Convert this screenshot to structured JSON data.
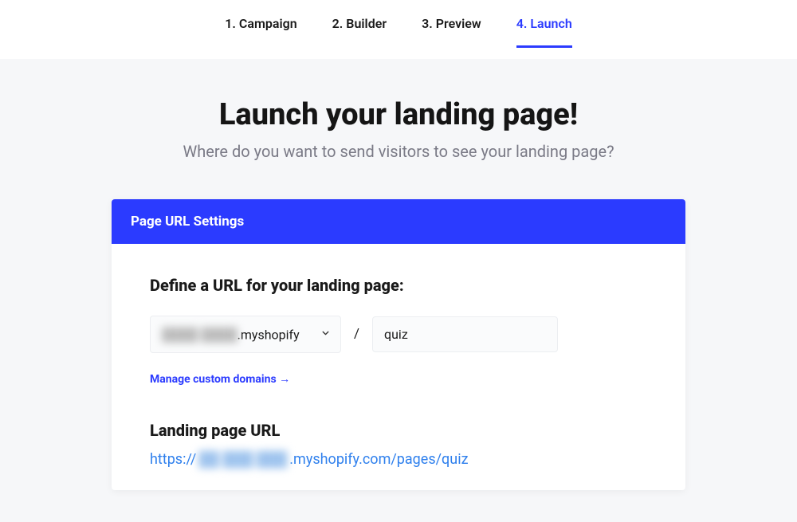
{
  "steps": [
    {
      "label": "1. Campaign",
      "active": false
    },
    {
      "label": "2. Builder",
      "active": false
    },
    {
      "label": "3. Preview",
      "active": false
    },
    {
      "label": "4. Launch",
      "active": true
    }
  ],
  "hero": {
    "title": "Launch your landing page!",
    "subtitle": "Where do you want to send visitors to see your landing page?"
  },
  "card": {
    "header": "Page URL Settings",
    "define_label": "Define a URL for your landing page:",
    "domain_blur_placeholder": "████ ████",
    "domain_suffix": ".myshopify",
    "slug_value": "quiz",
    "separator": "/",
    "manage_link": "Manage custom domains →"
  },
  "result": {
    "label": "Landing page URL",
    "protocol": "https://",
    "blur_placeholder": "██  ███  ███",
    "suffix": ".myshopify.com/pages/quiz"
  }
}
